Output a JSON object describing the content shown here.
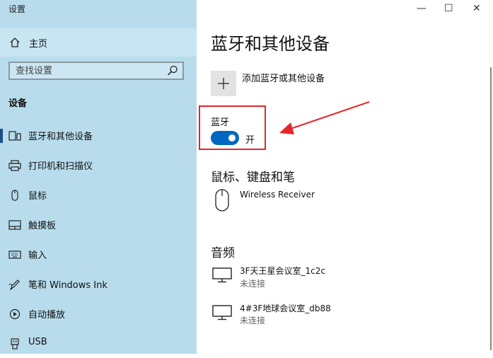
{
  "window": {
    "title": "设置",
    "controls": {
      "minimize": "—",
      "maximize": "☐",
      "close": "✕"
    }
  },
  "sidebar": {
    "home_label": "主页",
    "search_placeholder": "查找设置",
    "section_title": "设备",
    "items": [
      {
        "label": "蓝牙和其他设备",
        "icon": "bluetooth-device-icon",
        "active": true
      },
      {
        "label": "打印机和扫描仪",
        "icon": "printer-icon",
        "active": false
      },
      {
        "label": "鼠标",
        "icon": "mouse-icon",
        "active": false
      },
      {
        "label": "触摸板",
        "icon": "touchpad-icon",
        "active": false
      },
      {
        "label": "输入",
        "icon": "keyboard-icon",
        "active": false
      },
      {
        "label": "笔和 Windows Ink",
        "icon": "pen-icon",
        "active": false
      },
      {
        "label": "自动播放",
        "icon": "autoplay-icon",
        "active": false
      },
      {
        "label": "USB",
        "icon": "usb-icon",
        "active": false
      }
    ]
  },
  "main": {
    "title": "蓝牙和其他设备",
    "add_device_label": "添加蓝牙或其他设备",
    "bluetooth": {
      "label": "蓝牙",
      "state_label": "开",
      "on": true
    },
    "mouse_section": {
      "title": "鼠标、键盘和笔",
      "devices": [
        {
          "name": "Wireless Receiver"
        }
      ]
    },
    "audio_section": {
      "title": "音频",
      "devices": [
        {
          "name": "3F天王星会议室_1c2c",
          "status": "未连接"
        },
        {
          "name": "4#3F地球会议室_db88",
          "status": "未连接"
        }
      ]
    }
  },
  "colors": {
    "sidebar_bg": "#b8dcec",
    "accent": "#0067c0",
    "highlight": "#e4262a"
  }
}
